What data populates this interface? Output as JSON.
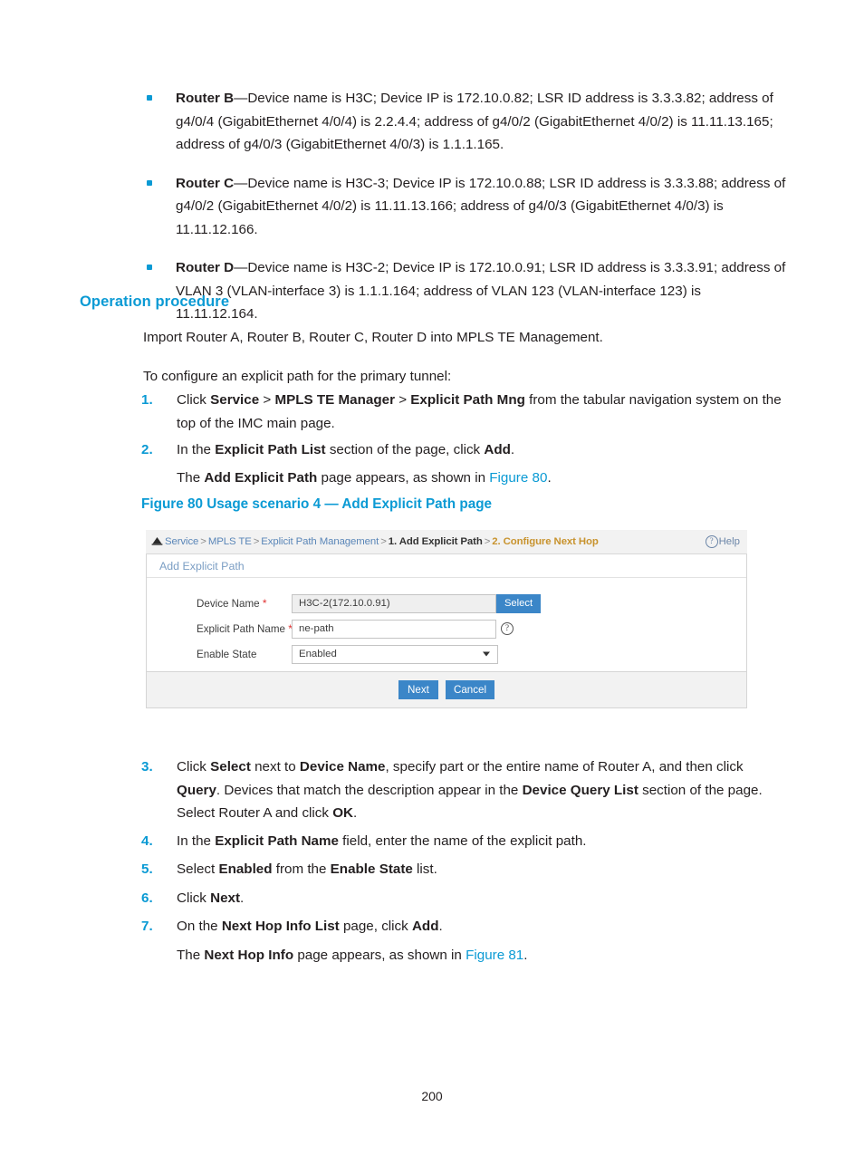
{
  "bullets": [
    {
      "label": "Router B",
      "text": "—Device name is H3C; Device IP is 172.10.0.82; LSR ID address is 3.3.3.82; address of g4/0/4 (GigabitEthernet 4/0/4) is 2.2.4.4; address of g4/0/2 (GigabitEthernet 4/0/2) is 11.11.13.165; address of g4/0/3 (GigabitEthernet 4/0/3) is 1.1.1.165."
    },
    {
      "label": "Router C",
      "text": "—Device name is H3C-3; Device IP is 172.10.0.88; LSR ID address is 3.3.3.88; address of g4/0/2 (GigabitEthernet 4/0/2) is 11.11.13.166; address of g4/0/3 (GigabitEthernet 4/0/3) is 11.11.12.166."
    },
    {
      "label": "Router D",
      "text": "—Device name is H3C-2; Device IP is 172.10.0.91; LSR ID address is 3.3.3.91; address of VLAN 3 (VLAN-interface 3) is 1.1.1.164; address of VLAN 123 (VLAN-interface 123) is 11.11.12.164."
    }
  ],
  "section_heading": "Operation procedure",
  "paragraphs": {
    "import": "Import Router A, Router B, Router C, Router D into MPLS TE Management.",
    "to_configure": "To configure an explicit path for the primary tunnel:"
  },
  "steps": {
    "n1": "1.",
    "n2": "2.",
    "n3": "3.",
    "n4": "4.",
    "n5": "5.",
    "n6": "6.",
    "n7": "7."
  },
  "step_text": {
    "s1_a": "Click ",
    "s1_service": "Service",
    "s1_gt1": " > ",
    "s1_mngr": "MPLS TE Manager",
    "s1_gt2": " > ",
    "s1_epm": "Explicit Path Mng",
    "s1_b": " from the tabular navigation system on the top of the IMC main page.",
    "s2_a": "In the ",
    "s2_epl": "Explicit Path List",
    "s2_b": " section of the page, click ",
    "s2_add": "Add",
    "s2_c": ".",
    "s2b_a": "The ",
    "s2b_aep": "Add Explicit Path",
    "s2b_b": " page appears, as shown in ",
    "s2b_link": "Figure 80",
    "s2b_c": ".",
    "s3_a": "Click ",
    "s3_select": "Select",
    "s3_b": " next to ",
    "s3_devname": "Device Name",
    "s3_c": ", specify part or the entire name of Router A, and then click ",
    "s3_query": "Query",
    "s3_d": ". Devices that match the description appear in the ",
    "s3_dql": "Device Query List",
    "s3_e": " section of the page. Select Router A and click ",
    "s3_ok": "OK",
    "s3_f": ".",
    "s4_a": "In the ",
    "s4_epn": "Explicit Path Name",
    "s4_b": " field, enter the name of the explicit path.",
    "s5_a": "Select ",
    "s5_enabled": "Enabled",
    "s5_b": " from the ",
    "s5_es": "Enable State",
    "s5_c": " list.",
    "s6_a": "Click ",
    "s6_next": "Next",
    "s6_b": ".",
    "s7_a": "On the ",
    "s7_nhil": "Next Hop Info List",
    "s7_b": " page, click ",
    "s7_add": "Add",
    "s7_c": ".",
    "s7b_a": "The ",
    "s7b_nhi": "Next Hop Info",
    "s7b_b": " page appears, as shown in ",
    "s7b_link": "Figure 81",
    "s7b_c": "."
  },
  "figure_caption": "Figure 80 Usage scenario 4 — Add Explicit Path page",
  "figure": {
    "breadcrumb": {
      "home_icon": "home-icon",
      "service": "Service",
      "sep1": ">",
      "mpls_te": "MPLS TE",
      "sep2": ">",
      "epm": "Explicit Path Management",
      "sep3": ">",
      "step1": "1. Add Explicit Path",
      "sep4": ">",
      "step2": "2. Configure Next Hop"
    },
    "help_label": "Help",
    "panel_title": "Add Explicit Path",
    "fields": {
      "device_name_label": "Device Name",
      "device_name_value": "H3C-2(172.10.0.91)",
      "select_button": "Select",
      "path_name_label": "Explicit Path Name",
      "path_name_value": "ne-path",
      "enable_state_label": "Enable State",
      "enable_state_value": "Enabled",
      "required_mark": "*"
    },
    "buttons": {
      "next": "Next",
      "cancel": "Cancel"
    }
  },
  "page_number": "200",
  "colors": {
    "accent_blue": "#0a9ad4",
    "button_blue": "#3b86c8",
    "crumb_active": "#c8932e",
    "required_red": "#e03030"
  }
}
